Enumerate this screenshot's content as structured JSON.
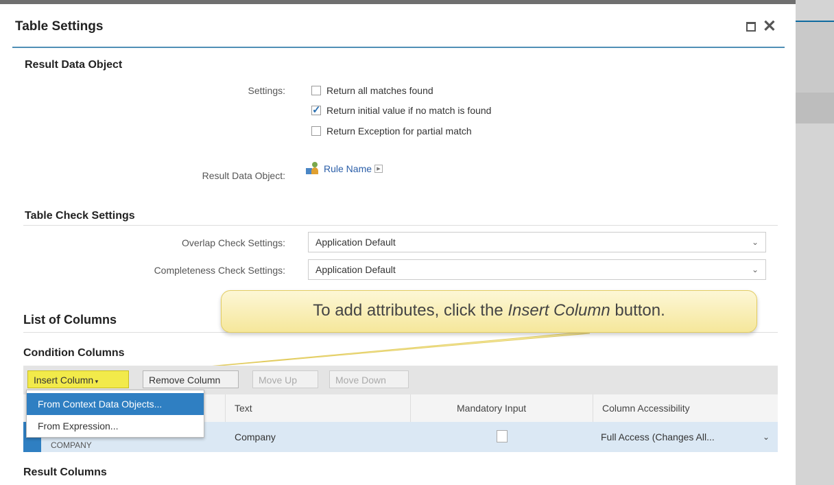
{
  "dialog": {
    "title": "Table Settings"
  },
  "result_data_object": {
    "section_title": "Result Data Object",
    "settings_label": "Settings:",
    "checkboxes": [
      {
        "label": "Return all matches found",
        "checked": false
      },
      {
        "label": "Return initial value if no match is found",
        "checked": true
      },
      {
        "label": "Return Exception for partial match",
        "checked": false
      }
    ],
    "rdo_label": "Result Data Object:",
    "rdo_value": "Rule Name"
  },
  "table_check": {
    "section_title": "Table Check Settings",
    "overlap_label": "Overlap Check Settings:",
    "overlap_value": "Application Default",
    "completeness_label": "Completeness Check Settings:",
    "completeness_value": "Application Default"
  },
  "callout": {
    "text_before": "To add attributes, click the ",
    "text_em": "Insert Column",
    "text_after": " button."
  },
  "columns": {
    "section_title": "List of Columns",
    "condition_title": "Condition Columns",
    "toolbar": {
      "insert": "Insert Column",
      "remove": "Remove Column",
      "move_up": "Move Up",
      "move_down": "Move Down"
    },
    "menu": [
      {
        "label": "From Context Data Objects..."
      },
      {
        "label": "From Expression..."
      }
    ],
    "headers": {
      "text": "Text",
      "mandatory": "Mandatory Input",
      "accessibility": "Column Accessibility"
    },
    "rows": [
      {
        "name": "COMPANY",
        "text": "Company",
        "mandatory": false,
        "accessibility": "Full Access (Changes All..."
      }
    ],
    "result_title": "Result Columns"
  },
  "colors": {
    "accent": "#2f7fc2",
    "highlight": "#f2ea4a"
  }
}
